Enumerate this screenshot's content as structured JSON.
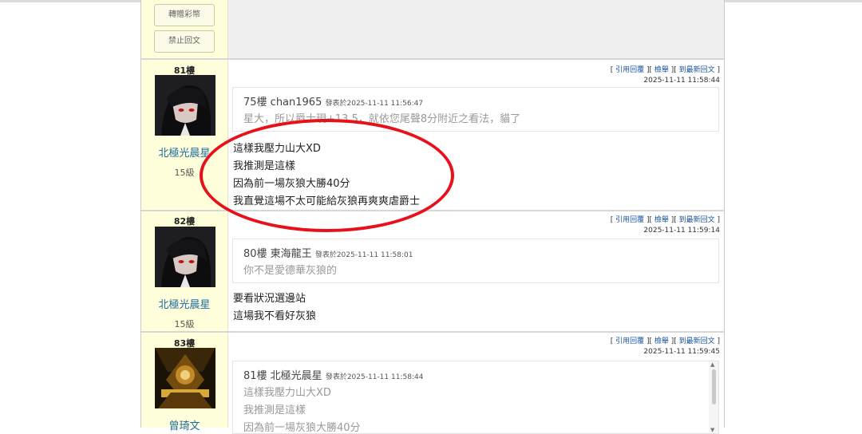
{
  "sidebar_buttons": {
    "transfer": "轉贈彩幣",
    "block_reply": "禁止回文"
  },
  "actions": {
    "quote": "引用回覆",
    "report": "檢舉",
    "latest": "到最新回文"
  },
  "posts": [
    {
      "floor": "81樓",
      "time": "2025-11-11 11:58:44",
      "user": {
        "name": "北極光晨星",
        "level": "15級"
      },
      "quote": {
        "author": "75樓 chan1965",
        "meta": "發表於2025-11-11 11:56:47",
        "lines": [
          "星大，所以爵士現+13.5，就依您尾聲8分附近之看法，貓了"
        ]
      },
      "body": [
        "這樣我壓力山大XD",
        "我推測是這樣",
        "因為前一場灰狼大勝40分",
        "我直覺這場不太可能給灰狼再爽爽虐爵士"
      ]
    },
    {
      "floor": "82樓",
      "time": "2025-11-11 11:59:14",
      "user": {
        "name": "北極光晨星",
        "level": "15級"
      },
      "quote": {
        "author": "80樓 東海龍王",
        "meta": "發表於2025-11-11 11:58:01",
        "lines": [
          "你不是愛德華灰狼的"
        ]
      },
      "body": [
        "要看狀況選邊站",
        "這場我不看好灰狼"
      ]
    },
    {
      "floor": "83樓",
      "time": "2025-11-11 11:59:45",
      "user": {
        "name": "曾琦文",
        "level": ""
      },
      "quote": {
        "author": "81樓 北極光晨星",
        "meta": "發表於2025-11-11 11:58:44",
        "lines": [
          "這樣我壓力山大XD",
          "我推測是這樣",
          "因為前一場灰狼大勝40分"
        ]
      },
      "body": []
    }
  ],
  "colors": {
    "sidebar_bg": "#ffffdc",
    "link": "#1a55a0",
    "username": "#1a6aa0",
    "highlight_ellipse": "#e8101a"
  },
  "icons": {
    "scroll_up": "scroll-up-arrow-icon",
    "scroll_down": "scroll-down-arrow-icon"
  }
}
